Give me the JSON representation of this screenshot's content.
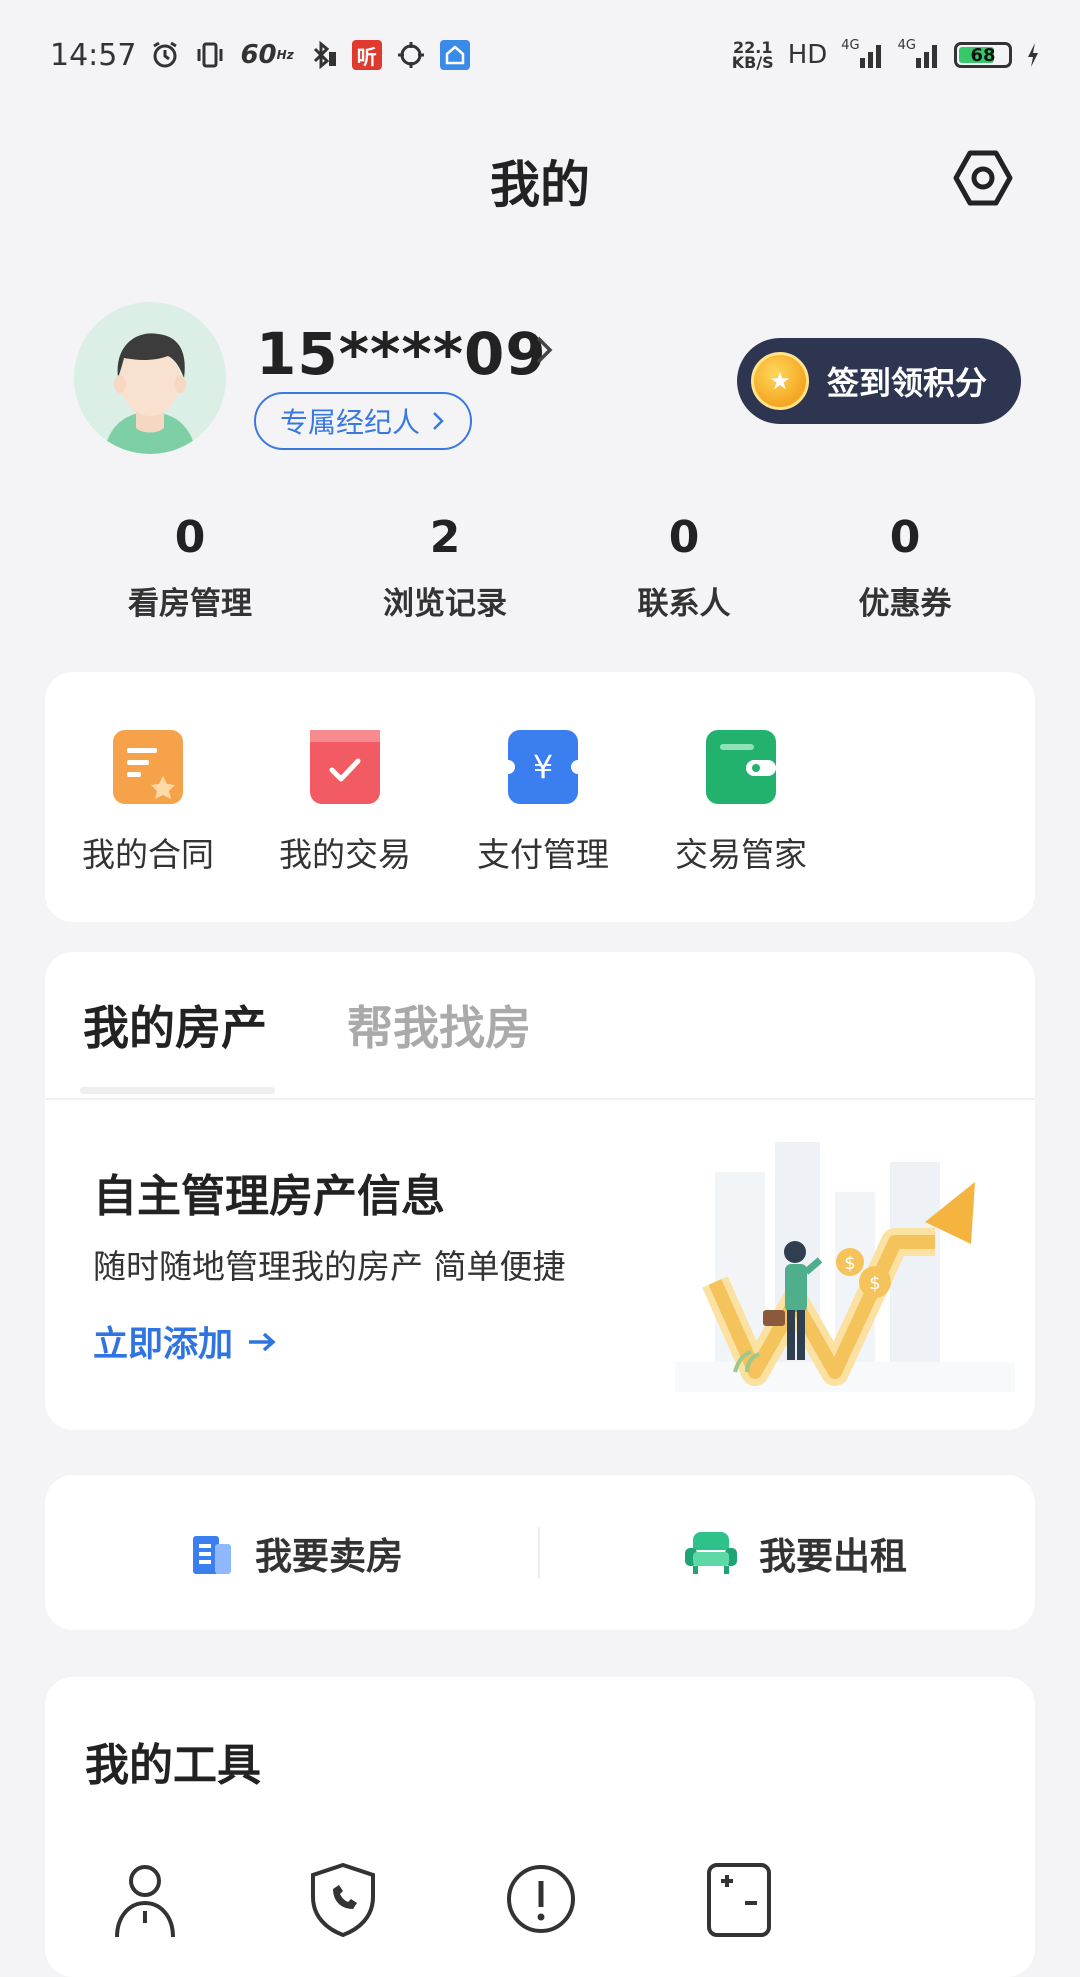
{
  "status_bar": {
    "time": "14:57",
    "refresh_rate": "60",
    "refresh_unit": "Hz",
    "news_badge": "听",
    "net_speed_value": "22.1",
    "net_speed_unit": "KB/S",
    "hd_label": "HD",
    "network_1": "4G",
    "network_2": "4G",
    "battery": "68"
  },
  "header": {
    "title": "我的"
  },
  "profile": {
    "phone": "15****09",
    "agent_tag": "专属经纪人",
    "signin_label": "签到领积分"
  },
  "stats": [
    {
      "value": "0",
      "label": "看房管理"
    },
    {
      "value": "2",
      "label": "浏览记录"
    },
    {
      "value": "0",
      "label": "联系人"
    },
    {
      "value": "0",
      "label": "优惠券"
    }
  ],
  "quick_actions": [
    {
      "label": "我的合同",
      "icon": "contract-icon",
      "color": "#f5a24a"
    },
    {
      "label": "我的交易",
      "icon": "transaction-icon",
      "color": "#f25b63"
    },
    {
      "label": "支付管理",
      "icon": "payment-icon",
      "color": "#3a7ef0",
      "glyph": "¥"
    },
    {
      "label": "交易管家",
      "icon": "wallet-icon",
      "color": "#23b26d"
    }
  ],
  "property": {
    "tabs": [
      {
        "label": "我的房产",
        "active": true
      },
      {
        "label": "帮我找房",
        "active": false
      }
    ],
    "title": "自主管理房产信息",
    "subtitle": "随时随地管理我的房产 简单便捷",
    "add_link": "立即添加"
  },
  "sell_rent": {
    "sell_label": "我要卖房",
    "rent_label": "我要出租"
  },
  "tools": {
    "title": "我的工具",
    "items": [
      {
        "icon": "person-icon"
      },
      {
        "icon": "shield-phone-icon"
      },
      {
        "icon": "alert-icon"
      },
      {
        "icon": "calculator-icon"
      }
    ]
  },
  "colors": {
    "accent": "#2f74e0",
    "signin_bg": "#2d3550",
    "page_bg": "#f4f4f6"
  }
}
